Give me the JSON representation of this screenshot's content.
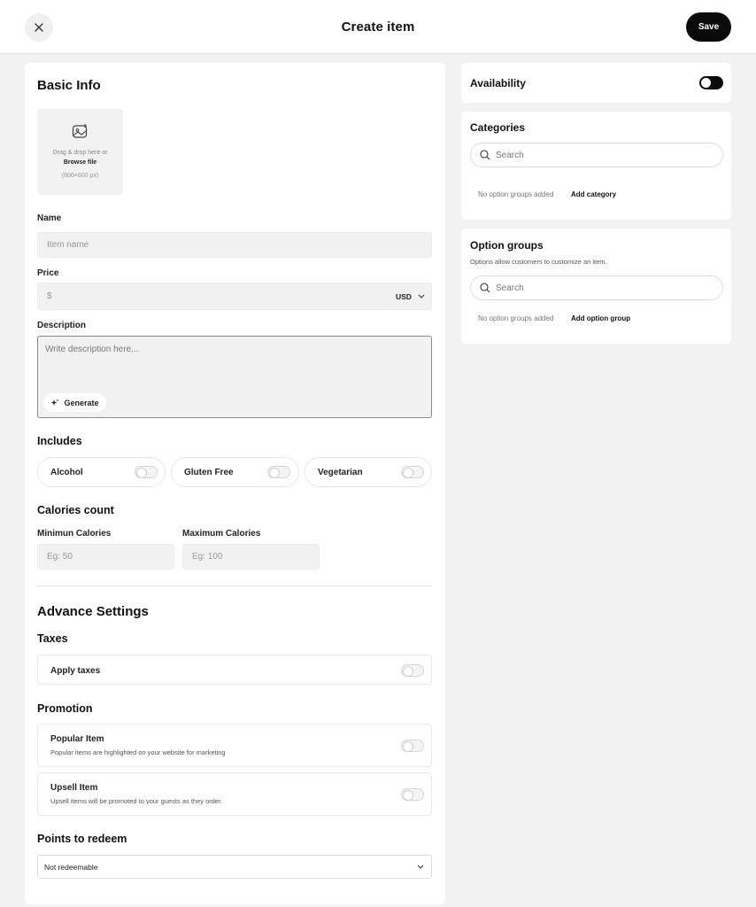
{
  "header": {
    "title": "Create item",
    "save_label": "Save"
  },
  "basic_info": {
    "heading": "Basic Info",
    "upload": {
      "line1": "Drag & drop here or",
      "browse": "Browse file",
      "size_hint": "(600×600 px)"
    },
    "name_label": "Name",
    "name_placeholder": "Item name",
    "price_label": "Price",
    "price_placeholder": "$",
    "currency": "USD",
    "description_label": "Description",
    "description_placeholder": "Write description here...",
    "generate_label": "Generate"
  },
  "includes": {
    "heading": "Includes",
    "options": [
      {
        "label": "Alcohol",
        "on": false
      },
      {
        "label": "Gluten Free",
        "on": false
      },
      {
        "label": "Vegetarian",
        "on": false
      }
    ]
  },
  "calories": {
    "heading": "Calories count",
    "min_label": "Minimun Calories",
    "min_placeholder": "Eg: 50",
    "max_label": "Maximum Calories",
    "max_placeholder": "Eg: 100"
  },
  "advanced": {
    "heading": "Advance Settings",
    "taxes_heading": "Taxes",
    "apply_taxes_label": "Apply taxes",
    "promotion_heading": "Promotion",
    "popular_title": "Popular Item",
    "popular_desc": "Popular items are highlighted on your website for marketing",
    "upsell_title": "Upsell Item",
    "upsell_desc": "Upsell items will be promoted to your guests as they order.",
    "points_heading": "Points to redeem",
    "points_value": "Not redeemable"
  },
  "availability": {
    "label": "Availability",
    "on": true
  },
  "categories": {
    "heading": "Categories",
    "search_placeholder": "Search",
    "empty_text": "No option groups added",
    "add_label": "Add category"
  },
  "option_groups": {
    "heading": "Option groups",
    "subtitle": "Options allow customers to customize an item.",
    "search_placeholder": "Search",
    "empty_text": "No option groups added",
    "add_label": "Add option group"
  },
  "colors": {
    "accent": "#0a0a0a",
    "background": "#f2f2f2",
    "input_bg": "#f1f1f1"
  }
}
